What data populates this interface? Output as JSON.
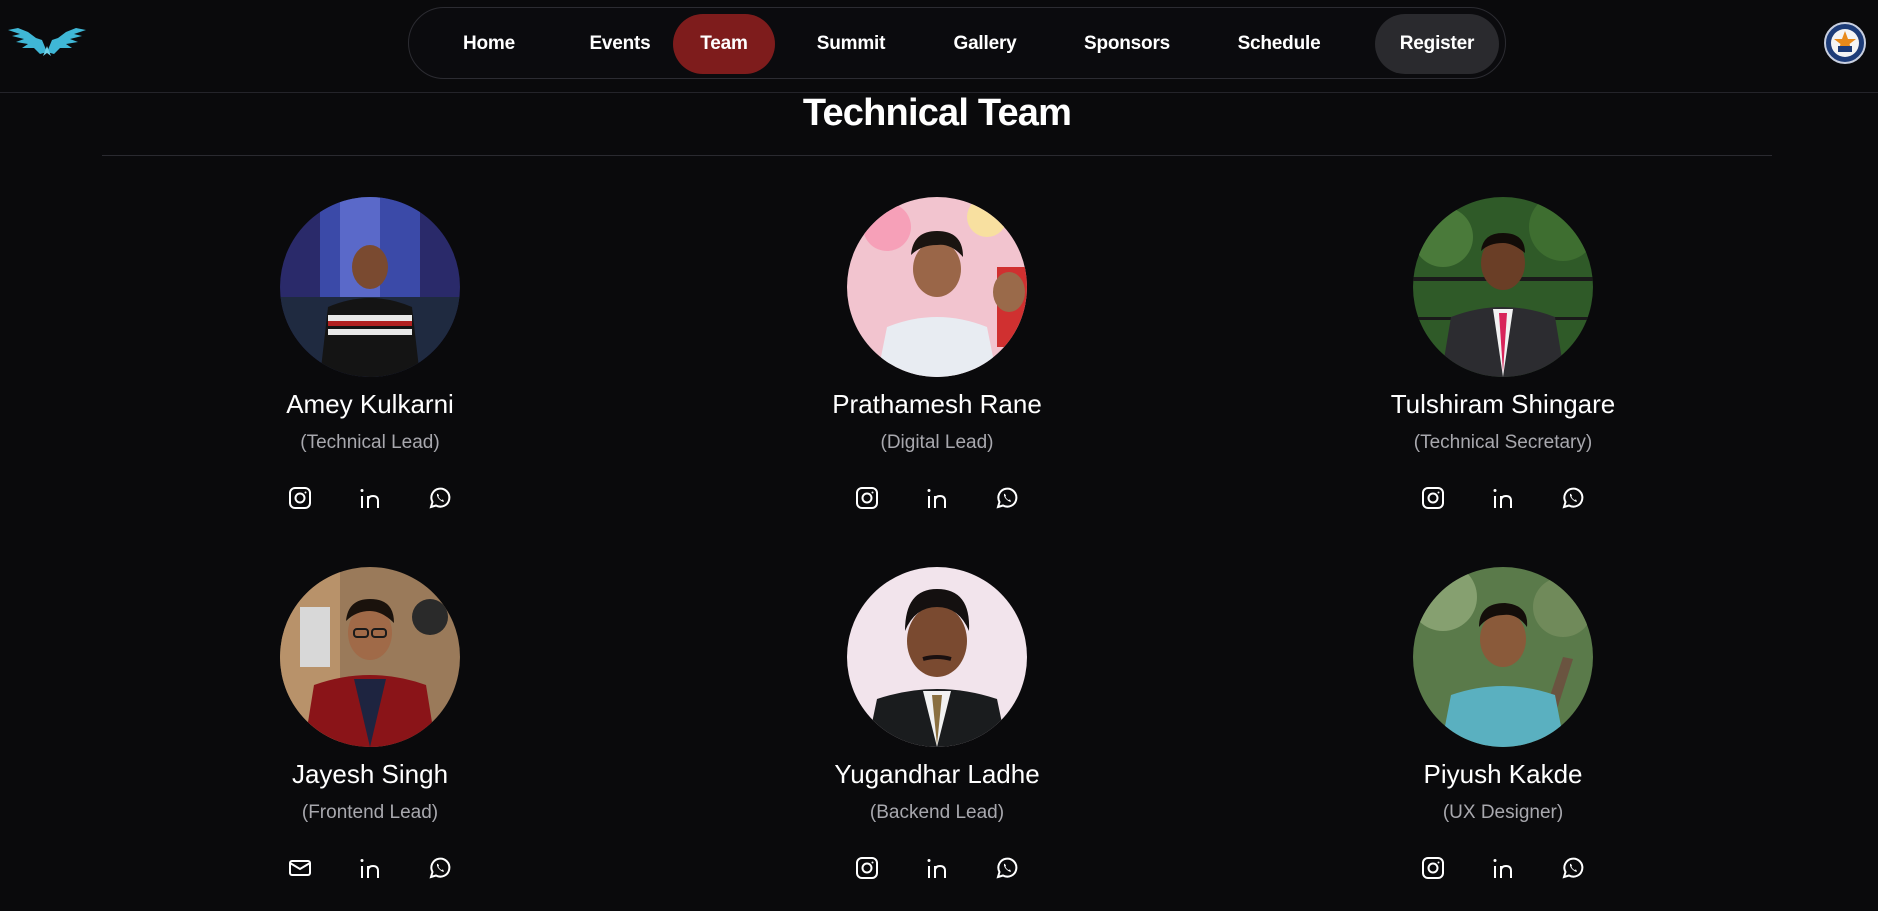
{
  "nav": {
    "items": [
      {
        "label": "Home"
      },
      {
        "label": "Events"
      },
      {
        "label": "Team",
        "active": true
      },
      {
        "label": "Summit"
      },
      {
        "label": "Gallery"
      },
      {
        "label": "Sponsors"
      },
      {
        "label": "Schedule"
      },
      {
        "label": "Register"
      }
    ],
    "active_color": "#7e1c1c"
  },
  "header": {
    "logo_icon": "wings-logo-icon",
    "crest_icon": "college-crest-icon"
  },
  "section": {
    "title": "Technical Team"
  },
  "members": [
    {
      "name": "Amey Kulkarni",
      "role": "(Technical Lead)",
      "socials": [
        "instagram-icon",
        "linkedin-icon",
        "whatsapp-icon"
      ]
    },
    {
      "name": "Prathamesh Rane",
      "role": "(Digital Lead)",
      "socials": [
        "instagram-icon",
        "linkedin-icon",
        "whatsapp-icon"
      ]
    },
    {
      "name": "Tulshiram Shingare",
      "role": "(Technical Secretary)",
      "socials": [
        "instagram-icon",
        "linkedin-icon",
        "whatsapp-icon"
      ]
    },
    {
      "name": "Jayesh Singh",
      "role": "(Frontend Lead)",
      "socials": [
        "mail-icon",
        "linkedin-icon",
        "whatsapp-icon"
      ]
    },
    {
      "name": "Yugandhar Ladhe",
      "role": "(Backend Lead)",
      "socials": [
        "instagram-icon",
        "linkedin-icon",
        "whatsapp-icon"
      ]
    },
    {
      "name": "Piyush Kakde",
      "role": "(UX Designer)",
      "socials": [
        "instagram-icon",
        "linkedin-icon",
        "whatsapp-icon"
      ]
    }
  ]
}
